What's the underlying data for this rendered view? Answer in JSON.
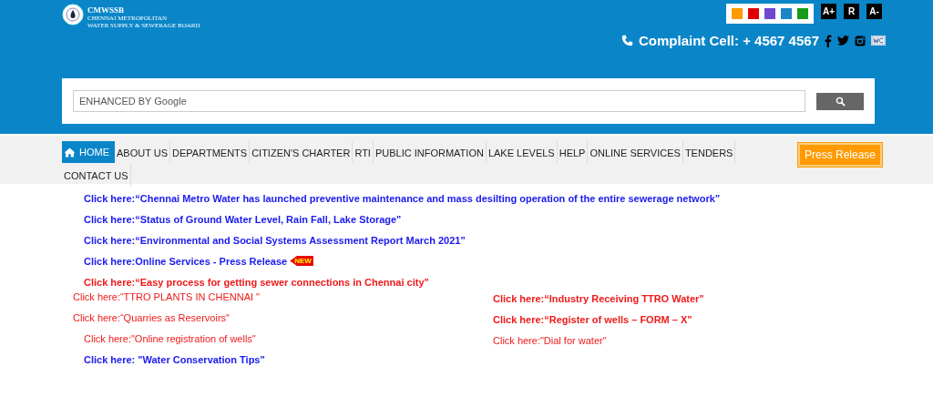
{
  "header": {
    "logo": {
      "acronym": "CMWSSB",
      "line_1": "CHENNAI METROPOLITAN",
      "line_2": "WATER SUPPLY & SEWERAGE BOARD"
    },
    "theme_colors": [
      {
        "color": "#ff9900"
      },
      {
        "color": "#e00000"
      },
      {
        "color": "#7048d0"
      },
      {
        "color": "#1a86c8"
      },
      {
        "color": "#1a9a1a"
      }
    ],
    "font_buttons": [
      "A+",
      "R",
      "A-"
    ],
    "complaint_cell": "Complaint Cell: + 4567 4567"
  },
  "search": {
    "placeholder": "ENHANCED BY Google"
  },
  "nav": {
    "items": [
      {
        "label": "HOME",
        "selected": true
      },
      {
        "label": "ABOUT US",
        "selected": false
      },
      {
        "label": "DEPARTMENTS",
        "selected": false
      },
      {
        "label": "CITIZEN'S CHARTER",
        "selected": false
      },
      {
        "label": "RTI",
        "selected": false
      },
      {
        "label": "PUBLIC INFORMATION",
        "selected": false
      },
      {
        "label": "LAKE LEVELS",
        "selected": false
      },
      {
        "label": "HELP",
        "selected": false
      },
      {
        "label": "ONLINE SERVICES",
        "selected": false
      },
      {
        "label": "TENDERS",
        "selected": false
      },
      {
        "label": "CONTACT US",
        "selected": false
      }
    ],
    "press_release": "Press Release"
  },
  "notices": [
    {
      "text": "Click here:“Chennai Metro Water has launched preventive maintenance and mass desilting operation of the entire sewerage network”",
      "color": "#1a1aee",
      "kind": "bold"
    },
    {
      "text": "Click here:“Status of Ground Water Level, Rain Fall, Lake Storage\"",
      "color": "#1a1aee",
      "kind": "bold"
    },
    {
      "text": "Click here:“Environmental and Social Systems Assessment Report March 2021\"",
      "color": "#1a1aee",
      "kind": "bold"
    },
    {
      "text": "Click here:Online Services - Press Release",
      "color": "#1a1aee",
      "kind": "bold",
      "badge": "NEW"
    },
    {
      "text": "Click here:“Easy process for getting sewer connections in Chennai city\"",
      "color": "#ee1a1a",
      "kind": "bold"
    }
  ],
  "left_links": [
    {
      "text": "Click here:“TTRO PLANTS IN CHENNAI \"",
      "color": "#ee1a1a",
      "kind": "flush"
    },
    {
      "text": "Click here:“Quarries as Reservoirs\"",
      "color": "#ee1a1a",
      "kind": "flush"
    },
    {
      "text": "Click here:\"Online registration of wells\"",
      "color": "#ee1a1a",
      "kind": "plain"
    },
    {
      "text": "Click here: \"Water Conservation Tips\"",
      "color": "#1a1aee",
      "kind": "bold"
    }
  ],
  "right_links": [
    {
      "text": "Click here:“Industry Receiving TTRO Water\"",
      "color": "#ee1a1a",
      "kind": "bold"
    },
    {
      "text": "Click here:“Register of wells – FORM – X\"",
      "color": "#ee1a1a",
      "kind": "bold"
    },
    {
      "text": "Click here:\"Dial for water\"",
      "color": "#ee1a1a",
      "kind": "plain"
    }
  ]
}
